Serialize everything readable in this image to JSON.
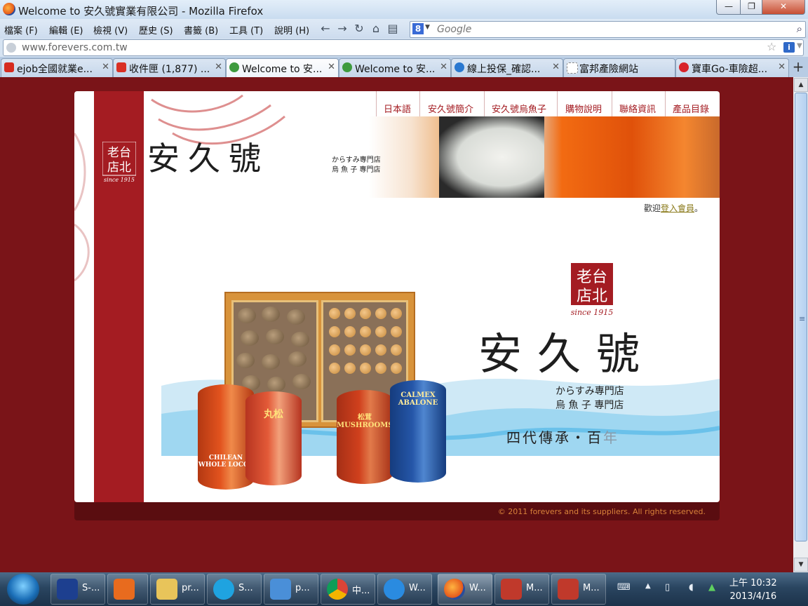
{
  "window": {
    "title": "Welcome to 安久號實業有限公司 - Mozilla Firefox",
    "min": "—",
    "max": "❐",
    "close": "✕"
  },
  "menu": [
    "檔案 (F)",
    "編輯 (E)",
    "檢視 (V)",
    "歷史 (S)",
    "書籤 (B)",
    "工具 (T)",
    "說明 (H)"
  ],
  "search": {
    "engine": "8",
    "placeholder": "Google"
  },
  "address": {
    "url": "www.forevers.com.tw"
  },
  "tabs": [
    {
      "label": "ejob全國就業e...",
      "icon_color": "#d62b1f"
    },
    {
      "label": "收件匣 (1,877) ...",
      "icon_color": "#d93025"
    },
    {
      "label": "Welcome to 安...",
      "icon_color": "#3e9a3e",
      "active": true
    },
    {
      "label": "Welcome to 安...",
      "icon_color": "#3e9a3e"
    },
    {
      "label": "線上投保_確認...",
      "icon_color": "#2a78d0"
    },
    {
      "label": "富邦產險網站",
      "icon_color": "#ffffff"
    },
    {
      "label": "寶車Go-車險超...",
      "icon_color": "#d8232a"
    }
  ],
  "site": {
    "nav": [
      "日本語",
      "安久號簡介",
      "安久號烏魚子",
      "購物說明",
      "聯絡資訊",
      "產品目錄"
    ],
    "brand": "安久號",
    "seal": {
      "line1": "老台",
      "line2": "店北",
      "since": "since 1915"
    },
    "sub_jp": "からすみ專門店",
    "sub_zh": "烏 魚 子 專門店",
    "welcome_prefix": "歡迎",
    "welcome_link": "登入會員",
    "welcome_suffix": "。",
    "tagline_main": "四代傳承・百",
    "tagline_fade": "年",
    "copyright": "© 2011 forevers and its suppliers. All rights reserved.",
    "cans": [
      {
        "text": "CHILEAN WHOLE LOCOS",
        "color": "#e2531e"
      },
      {
        "text": "丸松",
        "color": "#d8452a"
      },
      {
        "text": "松茸 MUSHROOMS",
        "color": "#d0401d"
      },
      {
        "text": "CALMEX ABALONE",
        "color": "#2556a8"
      }
    ]
  },
  "taskbar": {
    "items": [
      {
        "label": "S-...",
        "color": "#1d3f8f"
      },
      {
        "label": "",
        "color": "#e86b1e"
      },
      {
        "label": "pr...",
        "color": "#e8c45a"
      },
      {
        "label": "S...",
        "color": "#1fa3e0"
      },
      {
        "label": "p...",
        "color": "#4a8fd8"
      },
      {
        "label": "中...",
        "color": "#e2b023"
      },
      {
        "label": "W...",
        "color": "#2a8be0"
      },
      {
        "label": "W...",
        "color": "#e8701e",
        "active": true
      },
      {
        "label": "M...",
        "color": "#c0392b"
      },
      {
        "label": "M...",
        "color": "#c0392b"
      }
    ],
    "time": "上午 10:32",
    "date": "2013/4/16"
  }
}
